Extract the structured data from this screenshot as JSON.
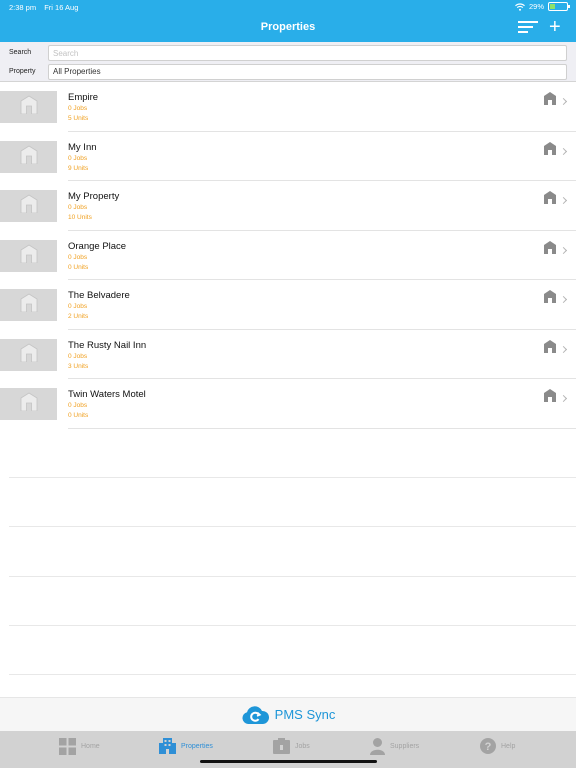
{
  "status_bar": {
    "time": "2:38 pm",
    "date": "Fri 16 Aug",
    "battery_percent": "29%",
    "battery_level": 0.29
  },
  "nav": {
    "title": "Properties",
    "sort_icon": "sort-lines-icon",
    "add_icon": "plus-icon"
  },
  "filters": {
    "search_label": "Search",
    "search_placeholder": "Search",
    "property_label": "Property",
    "property_value": "All Properties"
  },
  "properties": [
    {
      "name": "Empire",
      "jobs": "0 Jobs",
      "units": "5 Units"
    },
    {
      "name": "My Inn",
      "jobs": "0 Jobs",
      "units": "9 Units"
    },
    {
      "name": "My Property",
      "jobs": "0 Jobs",
      "units": "10 Units"
    },
    {
      "name": "Orange Place",
      "jobs": "0 Jobs",
      "units": "0 Units"
    },
    {
      "name": "The Belvadere",
      "jobs": "0 Jobs",
      "units": "2 Units"
    },
    {
      "name": "The Rusty Nail Inn",
      "jobs": "0 Jobs",
      "units": "3 Units"
    },
    {
      "name": "Twin Waters Motel",
      "jobs": "0 Jobs",
      "units": "0 Units"
    }
  ],
  "brand": {
    "name": "PMS Sync",
    "logo_icon": "cloud-sync-logo"
  },
  "tabs": [
    {
      "label": "Home",
      "icon": "grid-icon",
      "active": false
    },
    {
      "label": "Properties",
      "icon": "building-icon",
      "active": true
    },
    {
      "label": "Jobs",
      "icon": "clipboard-icon",
      "active": false
    },
    {
      "label": "Suppliers",
      "icon": "person-icon",
      "active": false
    },
    {
      "label": "Help",
      "icon": "question-icon",
      "active": false
    }
  ],
  "colors": {
    "accent": "#29aee9",
    "active_tab": "#2f8fd6",
    "meta_text": "#f0a020",
    "brand": "#1e96d8"
  }
}
